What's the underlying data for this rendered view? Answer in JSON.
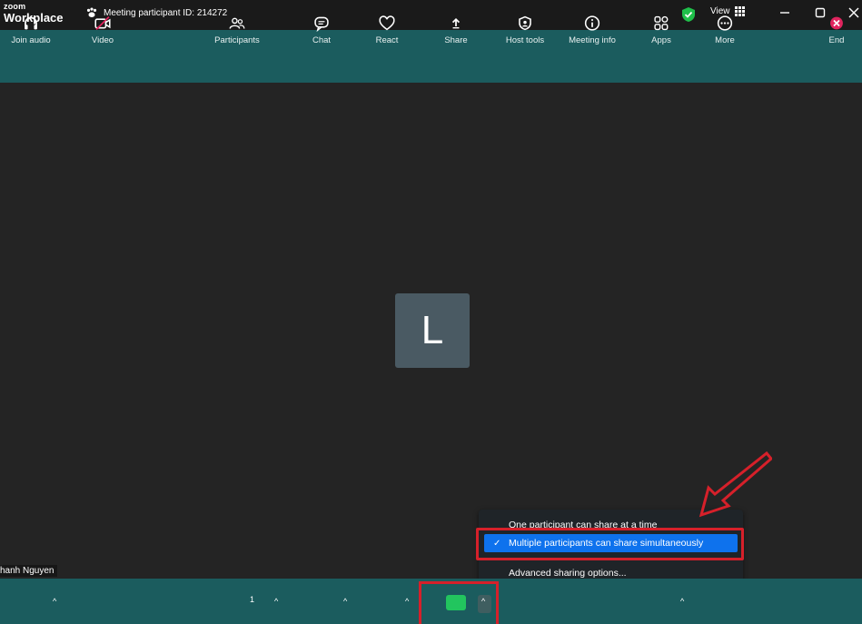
{
  "titlebar": {
    "brand_top": "zoom",
    "brand_bottom": "Workplace",
    "meeting_id": "Meeting participant ID: 214272",
    "view_label": "View"
  },
  "stage": {
    "avatar_letter": "L",
    "participant_name": "hanh Nguyen"
  },
  "share_menu": {
    "items": [
      {
        "label": "One participant can share at a time",
        "checked": false
      },
      {
        "label": "Multiple participants can share simultaneously",
        "checked": true
      },
      {
        "label": "Advanced sharing options...",
        "checked": false
      }
    ],
    "check_glyph": "✓"
  },
  "toolbar": {
    "join_audio": "Join audio",
    "video": "Video",
    "participants": "Participants",
    "participants_count": "1",
    "chat": "Chat",
    "react": "React",
    "share": "Share",
    "host_tools": "Host tools",
    "meeting_info": "Meeting info",
    "apps": "Apps",
    "more": "More",
    "end": "End",
    "caret_glyph": "^"
  },
  "colors": {
    "teal": "#1b5c5e",
    "highlight": "#0e72ed",
    "annotation": "#d6202a",
    "share_green": "#22c55e"
  }
}
